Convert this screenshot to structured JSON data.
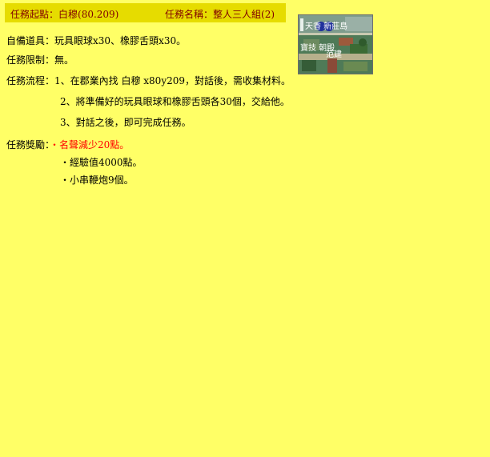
{
  "header": {
    "start_label": "任務起點：",
    "start_value": "白穆(80.209)",
    "name_label": "任務名稱：",
    "name_value": "整人三人組(2)"
  },
  "thumbnail": {
    "caption_top": "天香 新莊島",
    "caption_left": "寶技 朝殿",
    "caption_right": "范建"
  },
  "items": {
    "label": "自備道具：",
    "value": "玩具眼球x30、橡膠舌頭x30。"
  },
  "limit": {
    "label": "任務限制：",
    "value": "無。"
  },
  "process": {
    "label": "任務流程：",
    "steps": [
      "1、在郡業內找 白穆 x80y209，對話後，需收集材料。",
      "2、將準備好的玩具眼球和橡膠舌頭各30個，交給他。",
      "3、對話之後，即可完成任務。"
    ]
  },
  "reward": {
    "label": "任務獎勵：",
    "lines": [
      "・名聲減少20點。",
      "・經驗值4000點。",
      "・小串鞭炮9個。"
    ]
  },
  "colors": {
    "background": "#ffff66",
    "header_bar": "#e6dc00",
    "header_text": "#800000",
    "penalty": "#ff0000"
  }
}
